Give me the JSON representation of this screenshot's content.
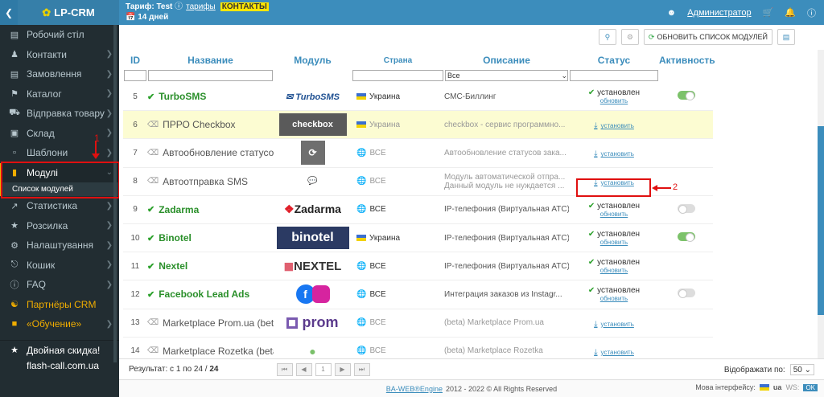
{
  "topbar": {
    "logo": "LP-CRM",
    "tariff_label": "Тариф:",
    "tariff_value": "Test",
    "tariffs_link": "тарифы",
    "contacts_link": "КОНТАКТЫ",
    "days": "14 дней",
    "user": "Администратор"
  },
  "sidebar": {
    "items": [
      {
        "label": "Робочий стіл",
        "icon": "desktop-icon"
      },
      {
        "label": "Контакти",
        "icon": "users-icon"
      },
      {
        "label": "Замовлення",
        "icon": "cart-icon"
      },
      {
        "label": "Каталог",
        "icon": "tag-icon"
      },
      {
        "label": "Відправка товару",
        "icon": "truck-icon"
      },
      {
        "label": "Склад",
        "icon": "warehouse-icon"
      },
      {
        "label": "Шаблони",
        "icon": "file-icon"
      },
      {
        "label": "Модулі",
        "icon": "puzzle-icon"
      },
      {
        "label": "Статистика",
        "icon": "chart-icon"
      },
      {
        "label": "Розсилка",
        "icon": "megaphone-icon"
      },
      {
        "label": "Налаштування",
        "icon": "gear-icon"
      },
      {
        "label": "Кошик",
        "icon": "trash-icon"
      },
      {
        "label": "FAQ",
        "icon": "info-icon"
      },
      {
        "label": "Партнёры CRM",
        "icon": "handshake-icon"
      },
      {
        "label": "«Обучение»",
        "icon": "video-icon"
      },
      {
        "label": "Двойная скидка!",
        "icon": "star-icon"
      },
      {
        "label": "flash-call.com.ua",
        "icon": "phone-icon"
      }
    ],
    "submenu_label": "Список модулей"
  },
  "annotations": {
    "one": "1",
    "two": "2"
  },
  "toolbar": {
    "refresh_label": "ОБНОВИТЬ СПИСОК МОДУЛЕЙ"
  },
  "table": {
    "headers": {
      "id": "ID",
      "name": "Название",
      "module": "Модуль",
      "country": "Страна",
      "desc": "Описание",
      "status": "Статус",
      "active": "Активность"
    },
    "filter_all": "Все",
    "rows": [
      {
        "id": "5",
        "name": "TurboSMS",
        "logo": "TurboSMS",
        "country": "Украина",
        "desc": "СМС-Биллинг",
        "status": "установлен",
        "link": "обновить",
        "active": "on"
      },
      {
        "id": "6",
        "name": "ПРРО Checkbox",
        "logo": "checkbox",
        "country": "Украина",
        "desc": "checkbox - сервис программно...",
        "status": "",
        "link": "установить",
        "active": ""
      },
      {
        "id": "7",
        "name": "Автообновление статусов",
        "logo": "",
        "country": "ВСЕ",
        "desc": "Автообновление статусов зака...",
        "status": "",
        "link": "установить",
        "active": ""
      },
      {
        "id": "8",
        "name": "Автоотправка SMS",
        "logo": "SMS",
        "country": "ВСЕ",
        "desc": "Модуль автоматической отпра...",
        "desc2": "Данный модуль не нуждается ...",
        "status": "",
        "link": "установить",
        "active": ""
      },
      {
        "id": "9",
        "name": "Zadarma",
        "logo": "Zadarma",
        "country": "ВСЕ",
        "desc": "IP-телефония (Виртуальная АТС)",
        "status": "установлен",
        "link": "обновить",
        "active": "off"
      },
      {
        "id": "10",
        "name": "Binotel",
        "logo": "binotel",
        "country": "Украина",
        "desc": "IP-телефония (Виртуальная АТС)",
        "status": "установлен",
        "link": "обновить",
        "active": "on"
      },
      {
        "id": "11",
        "name": "Nextel",
        "logo": "NEXTEL",
        "country": "ВСЕ",
        "desc": "IP-телефония (Виртуальная АТС)",
        "status": "установлен",
        "link": "обновить",
        "active": ""
      },
      {
        "id": "12",
        "name": "Facebook Lead Ads",
        "logo": "f",
        "country": "ВСЕ",
        "desc": "Интеграция заказов из Instagr...",
        "status": "установлен",
        "link": "обновить",
        "active": "off"
      },
      {
        "id": "13",
        "name": "Marketplace Prom.ua (beta)",
        "logo": "prom",
        "country": "ВСЕ",
        "desc": "(beta) Marketplace Prom.ua",
        "status": "",
        "link": "установить",
        "active": ""
      },
      {
        "id": "14",
        "name": "Marketplace Rozetka (beta)",
        "logo": "",
        "country": "ВСЕ",
        "desc": "(beta) Marketplace Rozetka",
        "status": "",
        "link": "установить",
        "active": ""
      }
    ]
  },
  "footer": {
    "results": "Результат: с 1 по 24 /",
    "total": "24",
    "page": "1",
    "per_page_label": "Відображати по:",
    "per_page": "50",
    "copyright_link": "BA-WEB®Engine",
    "copyright": "2012 - 2022 © All Rights Reserved",
    "lang_label": "Мова інтерфейсу:",
    "lang": "ua",
    "ws": "WS:",
    "ok": "OK"
  }
}
